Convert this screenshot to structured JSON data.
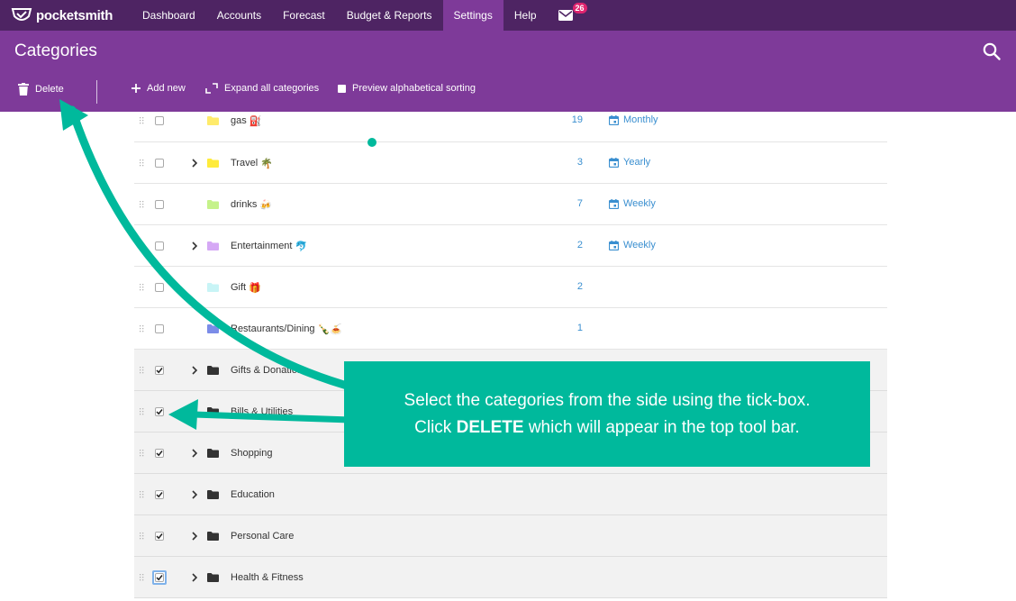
{
  "app": {
    "name": "pocketsmith"
  },
  "nav": {
    "items": [
      "Dashboard",
      "Accounts",
      "Forecast",
      "Budget & Reports",
      "Settings",
      "Help"
    ],
    "active": "Settings",
    "mail_badge": "26"
  },
  "header": {
    "title": "Categories",
    "toolbar": {
      "delete": "Delete",
      "add_new": "Add new",
      "expand_all": "Expand all categories",
      "preview_sort": "Preview alphabetical sorting"
    }
  },
  "colors": {
    "nav_bg": "#4e2463",
    "header_bg": "#7e3a99",
    "accent_link": "#3a8fd0",
    "annotation": "#00b99c"
  },
  "categories": [
    {
      "name": "gas",
      "emoji": "⛽",
      "folder_color": "#ffeb6b",
      "count": "19",
      "period": "Monthly",
      "checked": false,
      "expandable": false
    },
    {
      "name": "Travel",
      "emoji": "🌴",
      "folder_color": "#ffeb3b",
      "count": "3",
      "period": "Yearly",
      "checked": false,
      "expandable": true
    },
    {
      "name": "drinks",
      "emoji": "🍻",
      "folder_color": "#c5f28a",
      "count": "7",
      "period": "Weekly",
      "checked": false,
      "expandable": false
    },
    {
      "name": "Entertainment",
      "emoji": "🐬",
      "folder_color": "#d5a8f5",
      "count": "2",
      "period": "Weekly",
      "checked": false,
      "expandable": true
    },
    {
      "name": "Gift",
      "emoji": "🎁",
      "folder_color": "#c8f4f6",
      "count": "2",
      "period": "",
      "checked": false,
      "expandable": false
    },
    {
      "name": "Restaurants/Dining",
      "emoji": "🍾🍝",
      "folder_color": "#7b8ce8",
      "count": "1",
      "period": "",
      "checked": false,
      "expandable": false
    },
    {
      "name": "Gifts & Donations",
      "emoji": "",
      "folder_color": "#333333",
      "count": "",
      "period": "",
      "checked": true,
      "expandable": true
    },
    {
      "name": "Bills & Utilities",
      "emoji": "",
      "folder_color": "#333333",
      "count": "",
      "period": "",
      "checked": true,
      "expandable": true
    },
    {
      "name": "Shopping",
      "emoji": "",
      "folder_color": "#333333",
      "count": "",
      "period": "",
      "checked": true,
      "expandable": true
    },
    {
      "name": "Education",
      "emoji": "",
      "folder_color": "#333333",
      "count": "",
      "period": "",
      "checked": true,
      "expandable": true
    },
    {
      "name": "Personal Care",
      "emoji": "",
      "folder_color": "#333333",
      "count": "",
      "period": "",
      "checked": true,
      "expandable": true
    },
    {
      "name": "Health & Fitness",
      "emoji": "",
      "folder_color": "#333333",
      "count": "",
      "period": "",
      "checked": true,
      "expandable": true,
      "focused": true
    }
  ],
  "annotation": {
    "line1": "Select the categories from the side using the tick-box.",
    "line2_pre": "Click ",
    "line2_bold": "DELETE",
    "line2_post": " which will appear in the top tool bar."
  }
}
